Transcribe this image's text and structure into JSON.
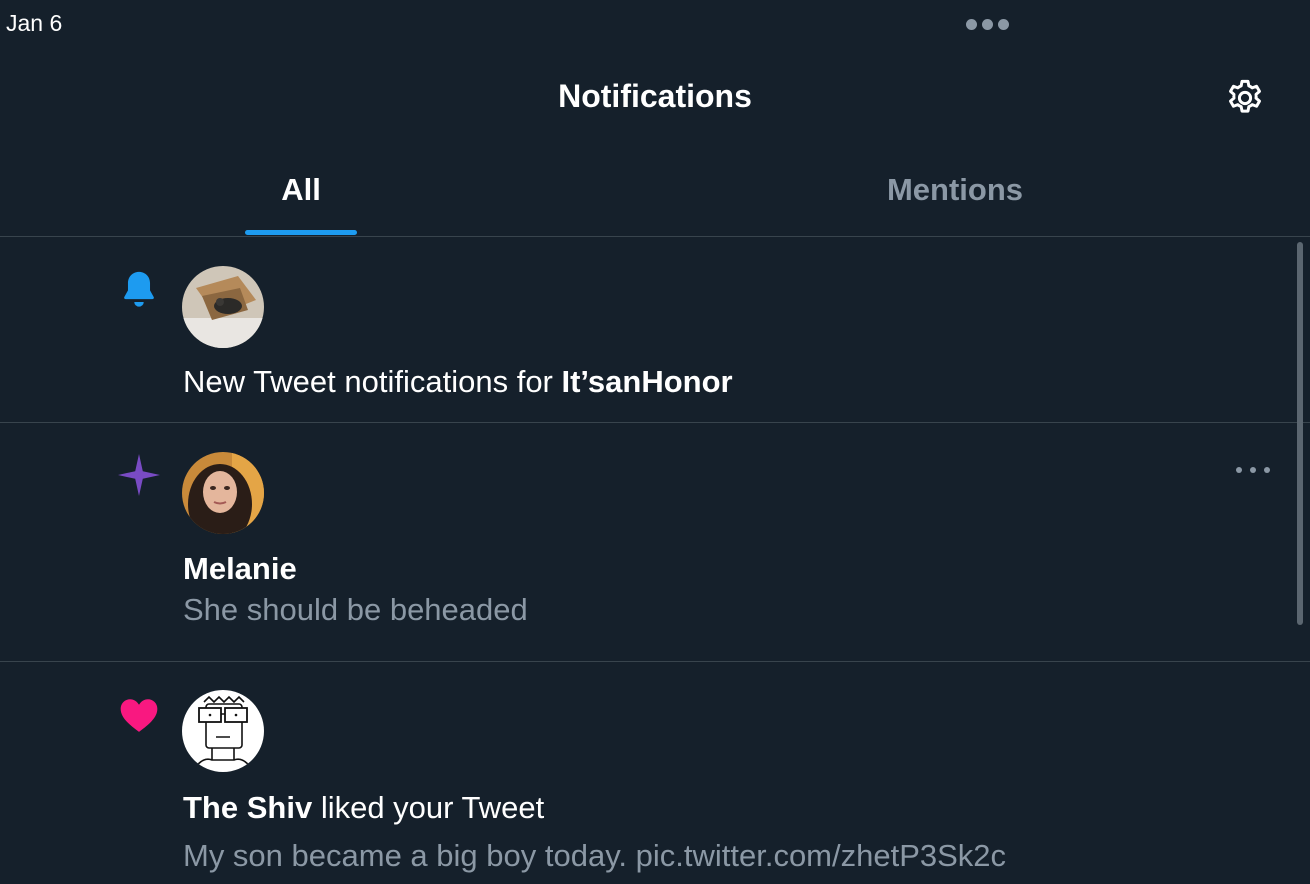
{
  "status_bar": {
    "date": "Jan 6"
  },
  "header": {
    "title": "Notifications",
    "settings_icon": "gear-icon"
  },
  "tabs": [
    {
      "label": "All",
      "active": true
    },
    {
      "label": "Mentions",
      "active": false
    }
  ],
  "colors": {
    "accent": "#1d9bf0",
    "background": "#15202b",
    "muted": "#8b98a5",
    "like": "#f91880",
    "spark": "#794bc4"
  },
  "notifications": [
    {
      "icon": "bell-icon",
      "text_prefix": "New Tweet notifications for ",
      "account": "It’sanHonor"
    },
    {
      "icon": "sparkle-icon",
      "user": "Melanie",
      "body": "She should be beheaded",
      "more_icon": "more-horizontal-icon"
    },
    {
      "icon": "heart-icon",
      "user": "The Shiv",
      "action": " liked your Tweet",
      "tweet_text": "My son became a big boy today. pic.twitter.com/zhetP3Sk2c"
    }
  ]
}
